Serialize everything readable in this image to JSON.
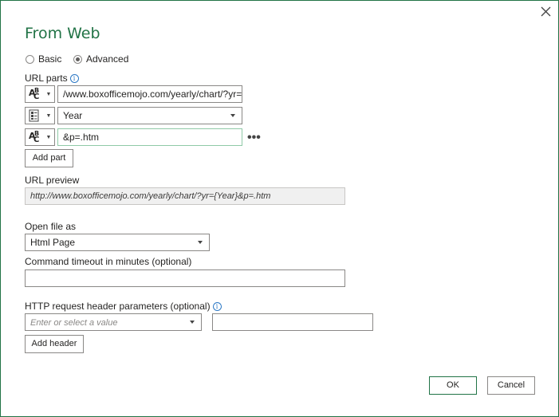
{
  "dialog": {
    "title": "From Web",
    "close_icon": "close-icon"
  },
  "mode": {
    "basic_label": "Basic",
    "advanced_label": "Advanced",
    "selected": "Advanced"
  },
  "url_parts": {
    "label": "URL parts",
    "parts": [
      {
        "type_icon": "text-type-icon",
        "value": "/www.boxofficemojo.com/yearly/chart/?yr="
      },
      {
        "type_icon": "parameter-type-icon",
        "value": "Year"
      },
      {
        "type_icon": "text-type-icon",
        "value": "&p=.htm"
      }
    ],
    "add_part_label": "Add part",
    "more_icon": "more-options-icon"
  },
  "url_preview": {
    "label": "URL preview",
    "value": "http://www.boxofficemojo.com/yearly/chart/?yr={Year}&p=.htm"
  },
  "open_file_as": {
    "label": "Open file as",
    "value": "Html Page"
  },
  "timeout": {
    "label": "Command timeout in minutes (optional)",
    "value": ""
  },
  "http_headers": {
    "label": "HTTP request header parameters (optional)",
    "name_placeholder": "Enter or select a value",
    "value": "",
    "add_header_label": "Add header"
  },
  "footer": {
    "ok_label": "OK",
    "cancel_label": "Cancel"
  },
  "colors": {
    "accent": "#217346",
    "info": "#2b78c5"
  }
}
